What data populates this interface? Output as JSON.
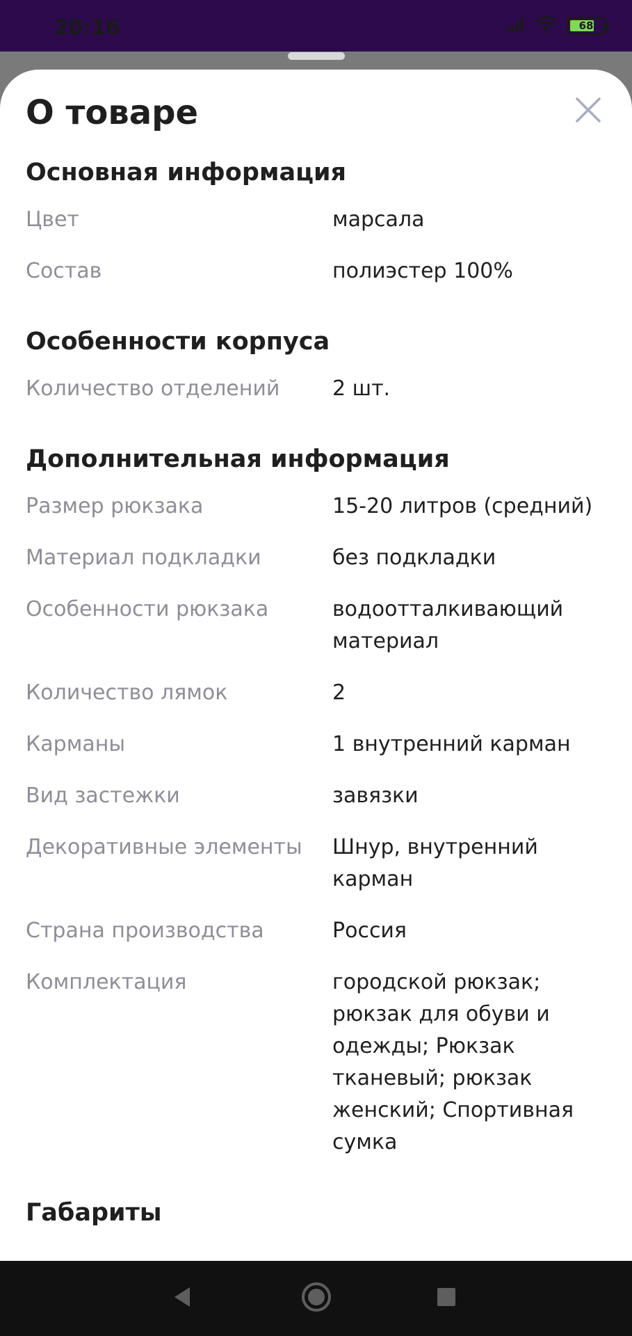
{
  "status_bar": {
    "time": "20:16",
    "battery_text": "68",
    "battery_level": 0.68,
    "icons": [
      "signal-icon",
      "wifi-icon",
      "battery-icon"
    ]
  },
  "sheet": {
    "title": "О товаре",
    "close_icon": "close-icon"
  },
  "sections": [
    {
      "title": "Основная информация",
      "rows": [
        {
          "label": "Цвет",
          "value": "марсала"
        },
        {
          "label": "Состав",
          "value": "полиэстер 100%"
        }
      ]
    },
    {
      "title": "Особенности корпуса",
      "rows": [
        {
          "label": "Количество отделений",
          "value": "2 шт."
        }
      ]
    },
    {
      "title": "Дополнительная информация",
      "rows": [
        {
          "label": "Размер рюкзака",
          "value": "15-20 литров (средний)"
        },
        {
          "label": "Материал подкладки",
          "value": "без подкладки"
        },
        {
          "label": "Особенности рюкзака",
          "value": "водоотталкивающий материал"
        },
        {
          "label": "Количество лямок",
          "value": "2"
        },
        {
          "label": "Карманы",
          "value": "1 внутренний карман"
        },
        {
          "label": "Вид застежки",
          "value": "завязки"
        },
        {
          "label": "Декоративные элементы",
          "value": "Шнур, внутренний карман"
        },
        {
          "label": "Страна производства",
          "value": "Россия"
        },
        {
          "label": "Комплектация",
          "value": "городской рюкзак; рюкзак для обуви и одежды; Рюкзак тканевый; рюкзак женский; Спортивная сумка"
        }
      ]
    },
    {
      "title": "Габариты",
      "rows": []
    }
  ],
  "nav_bar": {
    "icons": [
      "back-icon",
      "home-icon",
      "recents-icon"
    ]
  },
  "colors": {
    "status_bar": "#2d0a4c",
    "scrim": "#7a7a7a",
    "label": "#8e8e96",
    "value": "#1f1f1f",
    "battery_fill": "#7ed957"
  }
}
